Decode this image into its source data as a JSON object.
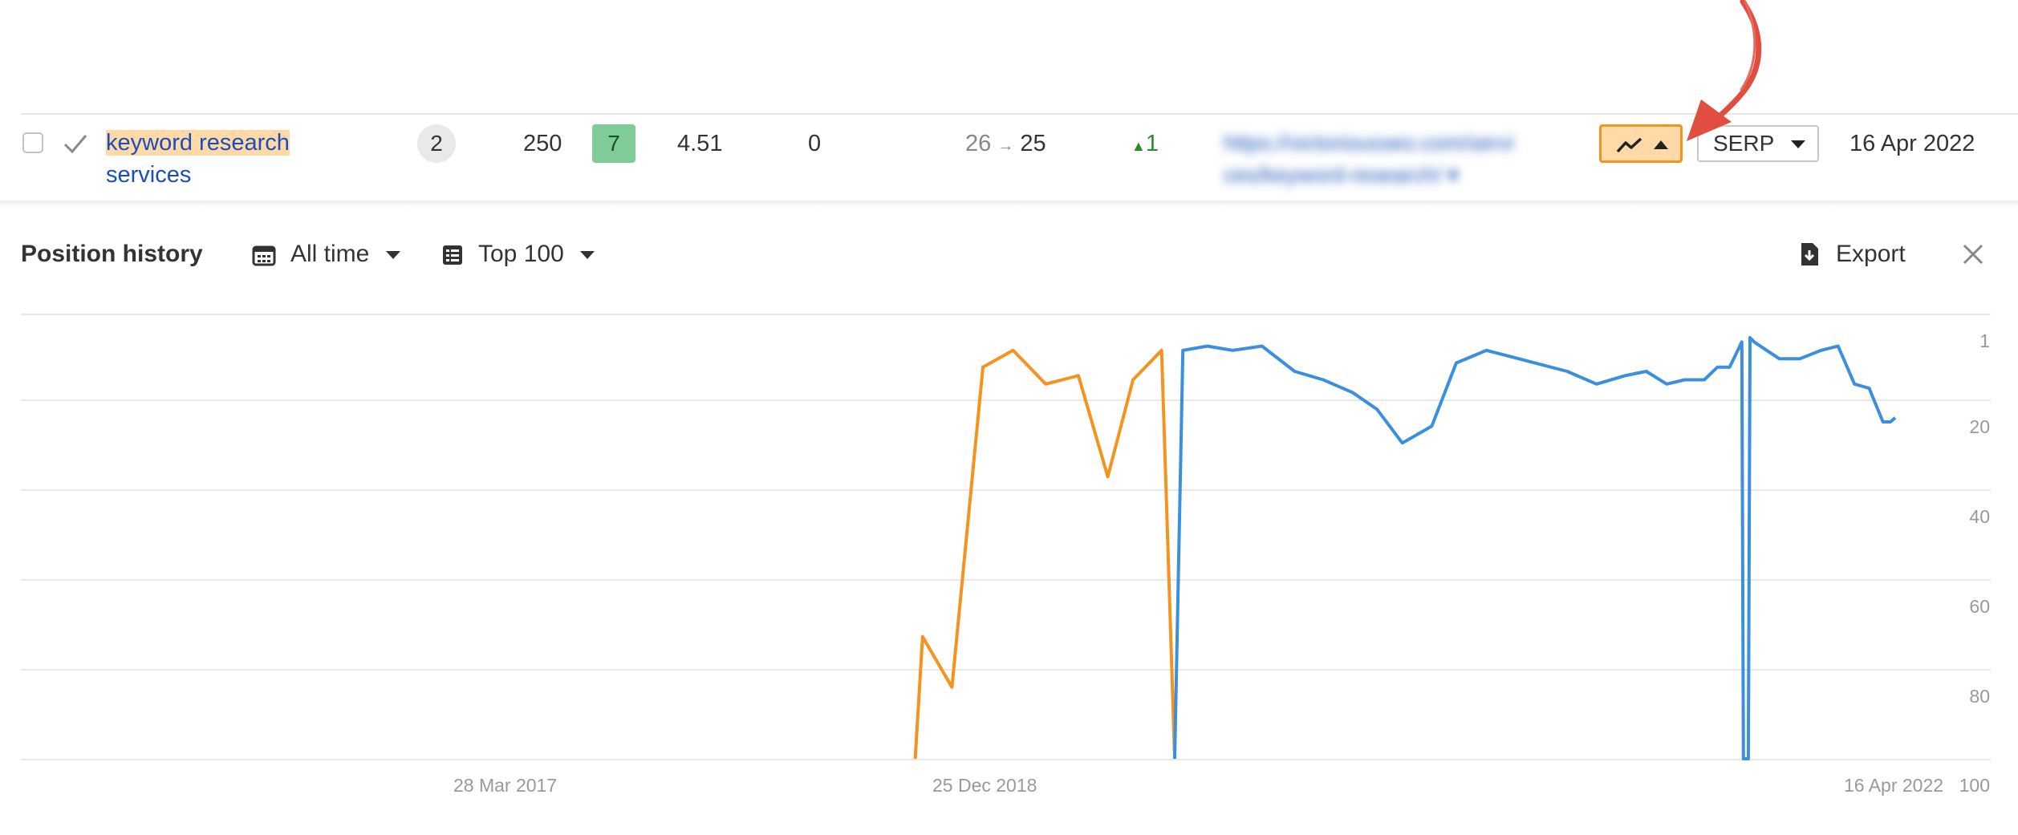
{
  "row": {
    "keyword_line1": "keyword research",
    "keyword_line2": "services",
    "serp_features": "2",
    "volume": "250",
    "kd": "7",
    "cpc": "4.51",
    "traffic": "0",
    "position_from": "26",
    "position_arrow": "→",
    "position_to": "25",
    "change": "1",
    "change_arrow": "▲",
    "url_line1": "https://victoriousseo.com/servi",
    "url_line2": "ces/keyword-research/ ▾",
    "serp_button": "SERP",
    "updated": "16 Apr 2022"
  },
  "toolbar": {
    "title": "Position history",
    "range_label": "All time",
    "top_label": "Top 100",
    "export_label": "Export"
  },
  "icons": [
    "checkbox",
    "check-icon",
    "trend-line-icon",
    "caret-up-icon",
    "caret-down-icon",
    "calendar-icon",
    "list-icon",
    "download-icon",
    "close-icon",
    "annotation-arrow"
  ],
  "colors": {
    "accent_orange": "#f5931f",
    "series_orange": "#f5931f",
    "series_blue": "#3b8fdc",
    "annotation_red": "#e04e3f",
    "link_blue": "#1a4fb8",
    "kd_green": "#7fcc98"
  },
  "chart_data": {
    "type": "line",
    "title": "Position history",
    "y_axis": {
      "reversed": true,
      "ticks": [
        1,
        20,
        40,
        60,
        80,
        100
      ],
      "range": [
        1,
        100
      ]
    },
    "x_axis": {
      "ticks": [
        "28 Mar 2017",
        "25 Dec 2018",
        "16 Apr 2022"
      ],
      "range": [
        "2016-01-01",
        "2022-04-16"
      ]
    },
    "grid": true,
    "series": [
      {
        "color": "#f5931f",
        "points": [
          [
            "2019-01-01",
            100
          ],
          [
            "2019-01-10",
            71
          ],
          [
            "2019-02-15",
            83
          ],
          [
            "2019-03-25",
            7
          ],
          [
            "2019-05-01",
            3
          ],
          [
            "2019-06-10",
            11
          ],
          [
            "2019-07-20",
            9
          ],
          [
            "2019-08-25",
            33
          ],
          [
            "2019-09-25",
            10
          ],
          [
            "2019-10-30",
            3
          ],
          [
            "2019-11-15",
            100
          ]
        ]
      },
      {
        "color": "#3b8fdc",
        "points": [
          [
            "2019-11-15",
            100
          ],
          [
            "2019-11-25",
            3
          ],
          [
            "2019-12-25",
            2
          ],
          [
            "2020-01-25",
            3
          ],
          [
            "2020-03-01",
            2
          ],
          [
            "2020-04-10",
            8
          ],
          [
            "2020-05-15",
            10
          ],
          [
            "2020-06-20",
            13
          ],
          [
            "2020-07-20",
            17
          ],
          [
            "2020-08-20",
            25
          ],
          [
            "2020-09-25",
            21
          ],
          [
            "2020-10-25",
            6
          ],
          [
            "2020-12-01",
            3
          ],
          [
            "2021-01-10",
            5
          ],
          [
            "2021-03-10",
            8
          ],
          [
            "2021-04-15",
            11
          ],
          [
            "2021-05-20",
            9
          ],
          [
            "2021-06-15",
            8
          ],
          [
            "2021-07-10",
            11
          ],
          [
            "2021-08-01",
            10
          ],
          [
            "2021-08-25",
            10
          ],
          [
            "2021-09-10",
            7
          ],
          [
            "2021-09-25",
            7
          ],
          [
            "2021-10-10",
            1
          ],
          [
            "2021-10-12",
            100
          ],
          [
            "2021-10-18",
            100
          ],
          [
            "2021-10-20",
            0
          ],
          [
            "2021-10-25",
            1
          ],
          [
            "2021-11-25",
            5
          ],
          [
            "2021-12-20",
            5
          ],
          [
            "2022-01-15",
            3
          ],
          [
            "2022-02-05",
            2
          ],
          [
            "2022-02-25",
            11
          ],
          [
            "2022-03-15",
            12
          ],
          [
            "2022-04-01",
            20
          ],
          [
            "2022-04-10",
            20
          ],
          [
            "2022-04-16",
            19
          ]
        ]
      }
    ]
  }
}
